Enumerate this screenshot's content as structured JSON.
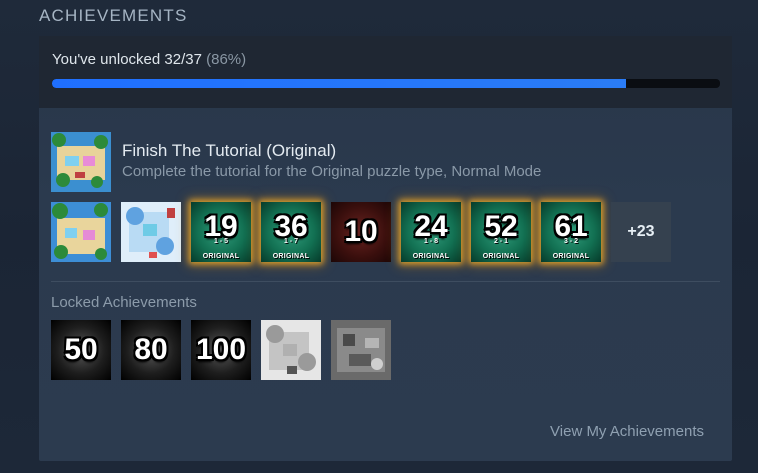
{
  "section": {
    "title": "ACHIEVEMENTS"
  },
  "progress": {
    "label": "You've unlocked 32/37",
    "percent_label": "(86%)",
    "fraction": 0.86
  },
  "featured": {
    "title": "Finish The Tutorial (Original)",
    "description": "Complete the tutorial for the Original puzzle type, Normal Mode",
    "icon": "tutorial-level-icon"
  },
  "unlocked": [
    {
      "kind": "image",
      "icon": "beach-puzzle-icon"
    },
    {
      "kind": "image",
      "icon": "snow-puzzle-icon"
    },
    {
      "kind": "badge",
      "color": "green",
      "number": "19",
      "sub": "1 - 5",
      "caption": "ORIGINAL"
    },
    {
      "kind": "badge",
      "color": "green",
      "number": "36",
      "sub": "1 - 7",
      "caption": "ORIGINAL"
    },
    {
      "kind": "badge",
      "color": "red",
      "number": "10",
      "sub": "",
      "caption": ""
    },
    {
      "kind": "badge",
      "color": "green",
      "number": "24",
      "sub": "1 - 8",
      "caption": "ORIGINAL"
    },
    {
      "kind": "badge",
      "color": "green",
      "number": "52",
      "sub": "2 - 1",
      "caption": "ORIGINAL"
    },
    {
      "kind": "badge",
      "color": "green",
      "number": "61",
      "sub": "3 - 2",
      "caption": "ORIGINAL"
    }
  ],
  "more_count": "+23",
  "locked_title": "Locked Achievements",
  "locked": [
    {
      "kind": "badge",
      "number": "50"
    },
    {
      "kind": "badge",
      "number": "80"
    },
    {
      "kind": "badge",
      "number": "100"
    },
    {
      "kind": "image",
      "icon": "grayscale-snow-puzzle-icon"
    },
    {
      "kind": "image",
      "icon": "grayscale-castle-puzzle-icon"
    }
  ],
  "view_link": "View My Achievements",
  "colors": {
    "accent": "#1f6fff",
    "glow": "#f0aa28"
  }
}
